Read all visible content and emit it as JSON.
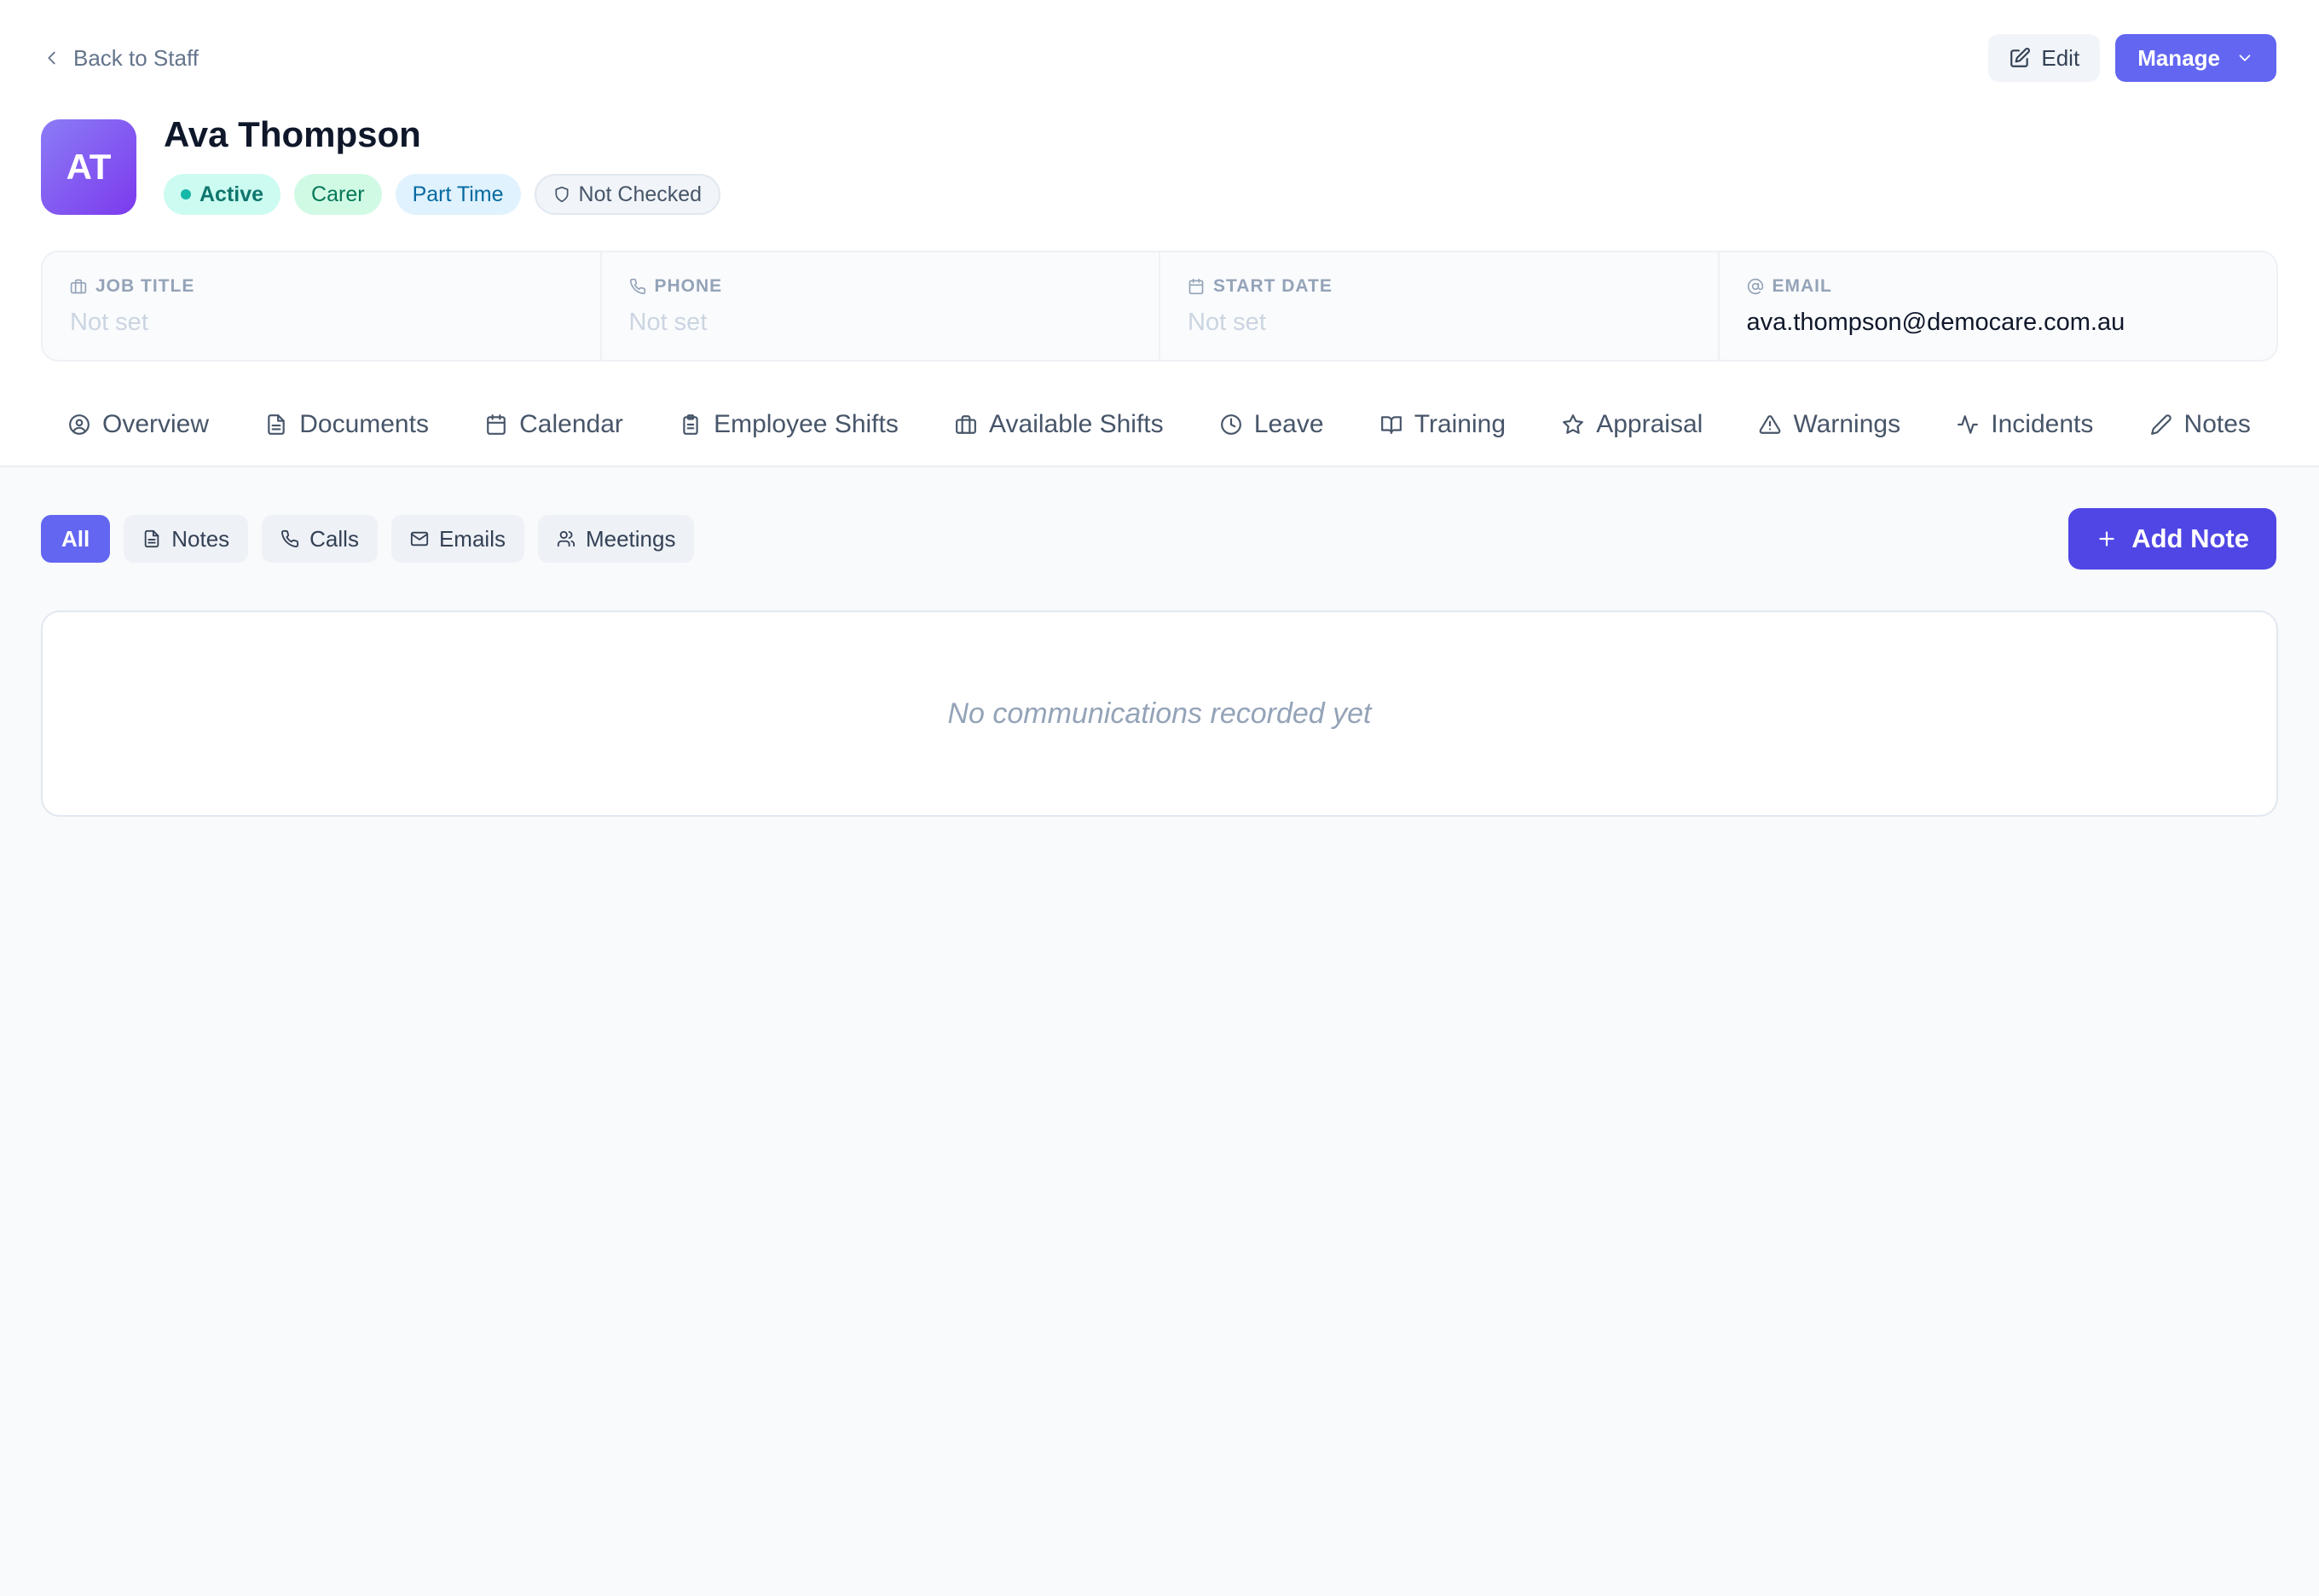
{
  "header": {
    "back_label": "Back to Staff",
    "edit_label": "Edit",
    "manage_label": "Manage"
  },
  "profile": {
    "initials": "AT",
    "name": "Ava Thompson",
    "badges": {
      "status": "Active",
      "role": "Carer",
      "employment": "Part Time",
      "check": "Not Checked"
    }
  },
  "info": {
    "job_title": {
      "label": "JOB TITLE",
      "value": "Not set"
    },
    "phone": {
      "label": "PHONE",
      "value": "Not set"
    },
    "start_date": {
      "label": "START DATE",
      "value": "Not set"
    },
    "email": {
      "label": "EMAIL",
      "value": "ava.thompson@democare.com.au"
    }
  },
  "tabs": [
    {
      "label": "Overview",
      "icon": "user-circle-icon"
    },
    {
      "label": "Documents",
      "icon": "document-icon"
    },
    {
      "label": "Calendar",
      "icon": "calendar-icon"
    },
    {
      "label": "Employee Shifts",
      "icon": "clipboard-icon"
    },
    {
      "label": "Available Shifts",
      "icon": "briefcase-icon"
    },
    {
      "label": "Leave",
      "icon": "clock-icon"
    },
    {
      "label": "Training",
      "icon": "book-icon"
    },
    {
      "label": "Appraisal",
      "icon": "star-icon"
    },
    {
      "label": "Warnings",
      "icon": "warning-icon"
    },
    {
      "label": "Incidents",
      "icon": "activity-icon"
    },
    {
      "label": "Notes",
      "icon": "pencil-icon"
    }
  ],
  "filters": {
    "all": "All",
    "notes": "Notes",
    "calls": "Calls",
    "emails": "Emails",
    "meetings": "Meetings"
  },
  "add_note_label": "Add Note",
  "empty_message": "No communications recorded yet",
  "colors": {
    "accent": "#6366f1",
    "accent_dark": "#4f46e5",
    "active_badge": "#ccfbf1",
    "carer_badge": "#d1fae5",
    "part_time_badge": "#e0f2fe"
  }
}
